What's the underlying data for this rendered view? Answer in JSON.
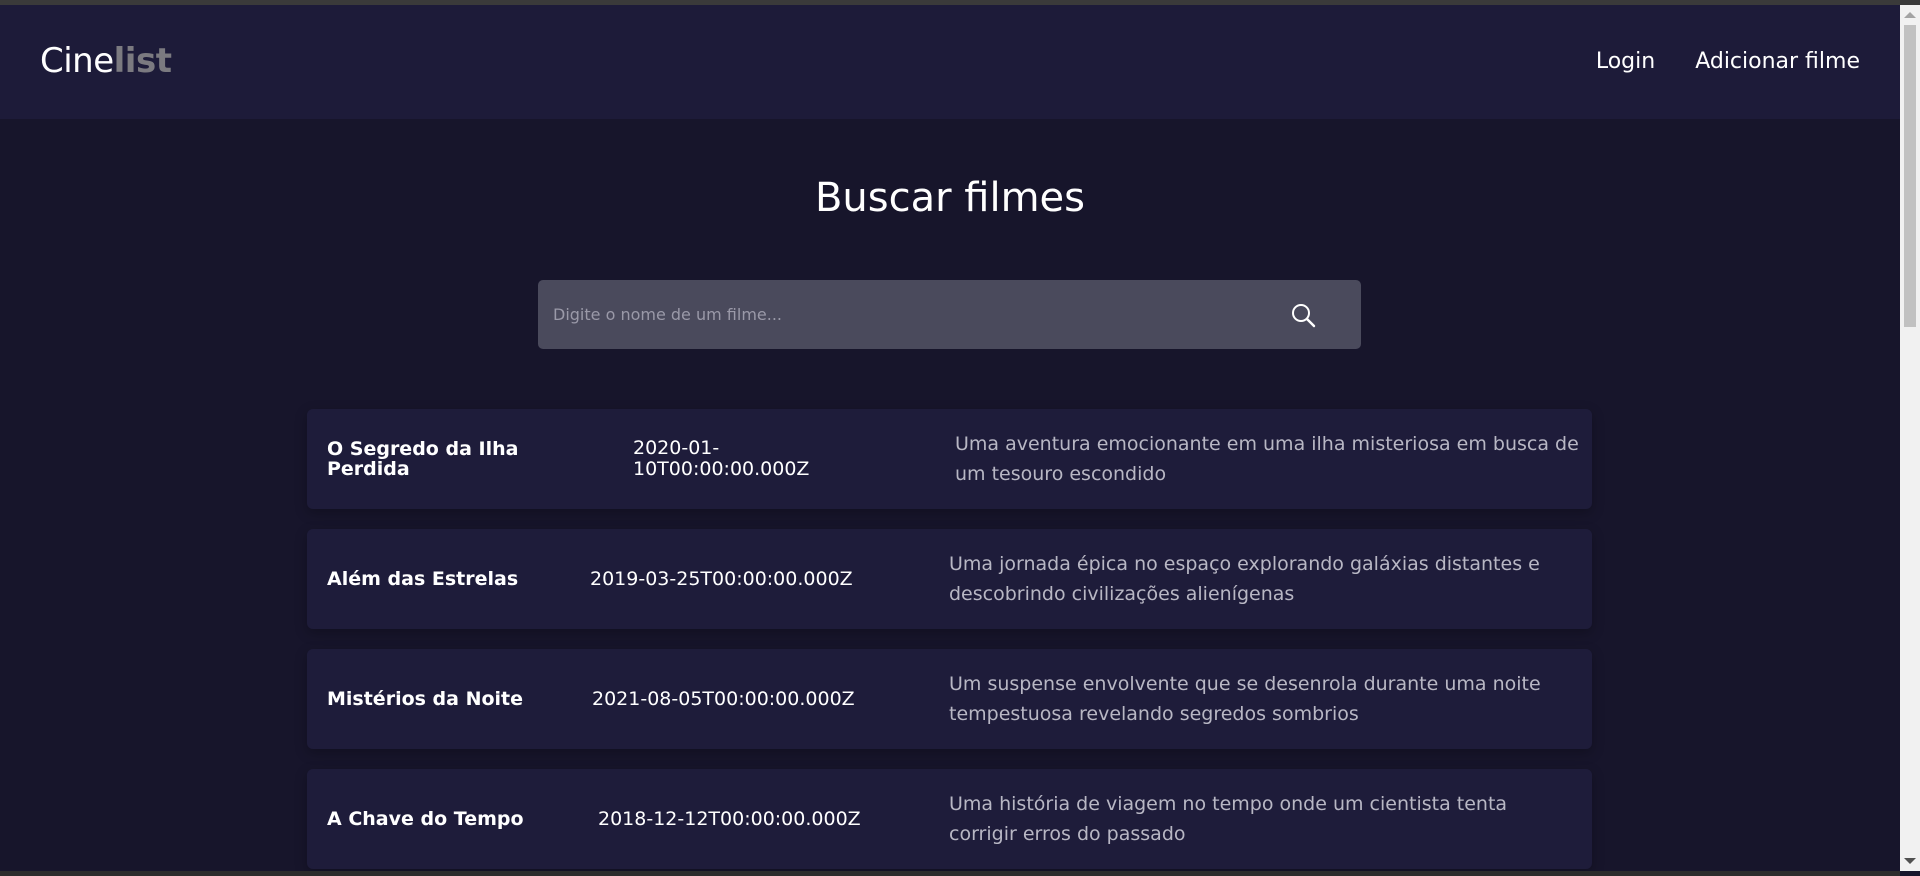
{
  "header": {
    "logo_part1": "Cine",
    "logo_part2": "list",
    "nav": {
      "login": "Login",
      "add_movie": "Adicionar filme"
    }
  },
  "main": {
    "title": "Buscar filmes",
    "search": {
      "placeholder": "Digite o nome de um filme...",
      "value": "",
      "icon": "search-icon"
    },
    "movies": [
      {
        "title": "O Segredo da Ilha Perdida",
        "date": "2020-01-10T00:00:00.000Z",
        "description": "Uma aventura emocionante em uma ilha misteriosa em busca de um tesouro escondido"
      },
      {
        "title": "Além das Estrelas",
        "date": "2019-03-25T00:00:00.000Z",
        "description": "Uma jornada épica no espaço explorando galáxias distantes e descobrindo civilizações alienígenas"
      },
      {
        "title": "Mistérios da Noite",
        "date": "2021-08-05T00:00:00.000Z",
        "description": "Um suspense envolvente que se desenrola durante uma noite tempestuosa revelando segredos sombrios"
      },
      {
        "title": "A Chave do Tempo",
        "date": "2018-12-12T00:00:00.000Z",
        "description": "Uma história de viagem no tempo onde um cientista tenta corrigir erros do passado"
      }
    ]
  },
  "colors": {
    "background": "#17152b",
    "header": "#1d1b39",
    "card": "#1e1c3a",
    "search_box": "#4a4a5c",
    "logo_accent": "#7b7a80",
    "description_text": "#b8b7c4"
  }
}
